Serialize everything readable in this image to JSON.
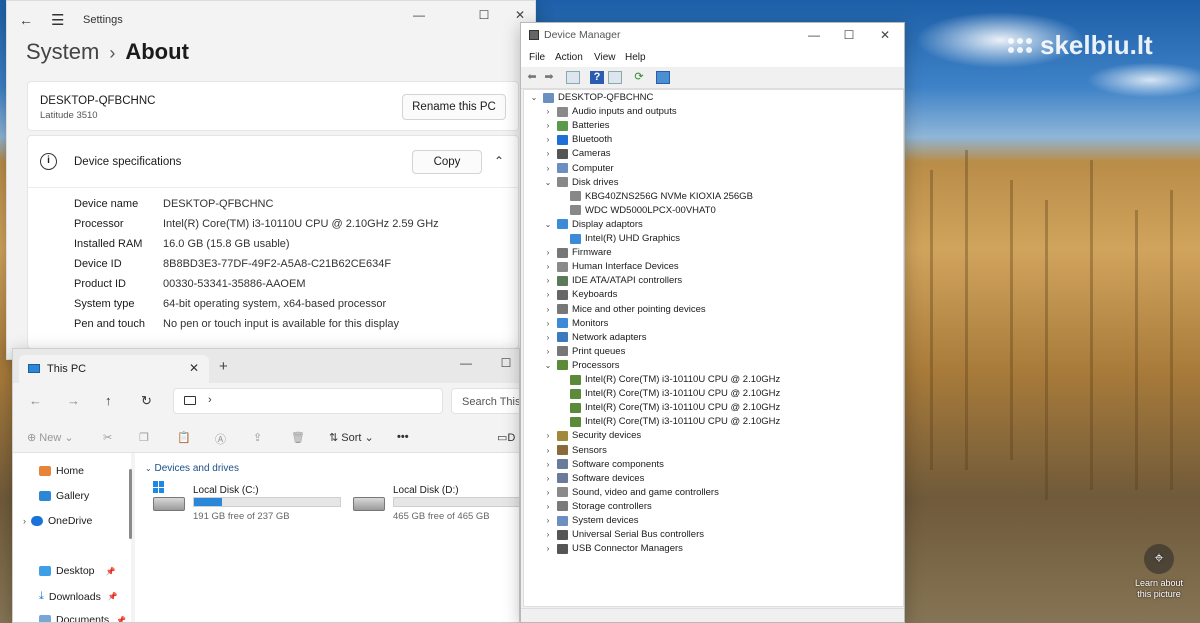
{
  "watermark": {
    "text": "skelbiu.lt"
  },
  "desktop": {
    "learn_about": "Learn about this picture"
  },
  "settings": {
    "window_title": "Settings",
    "breadcrumb_parent": "System",
    "breadcrumb_separator": "›",
    "breadcrumb_current": "About",
    "device_name": "DESKTOP-QFBCHNC",
    "device_model": "Latitude 3510",
    "rename_label": "Rename this PC",
    "specs_title": "Device specifications",
    "copy_label": "Copy",
    "specs": [
      {
        "label": "Device name",
        "value": "DESKTOP-QFBCHNC"
      },
      {
        "label": "Processor",
        "value": "Intel(R) Core(TM) i3-10110U CPU @ 2.10GHz   2.59 GHz"
      },
      {
        "label": "Installed RAM",
        "value": "16.0 GB (15.8 GB usable)"
      },
      {
        "label": "Device ID",
        "value": "8B8BD3E3-77DF-49F2-A5A8-C21B62CE634F"
      },
      {
        "label": "Product ID",
        "value": "00330-53341-35886-AAOEM"
      },
      {
        "label": "System type",
        "value": "64-bit operating system, x64-based processor"
      },
      {
        "label": "Pen and touch",
        "value": "No pen or touch input is available for this display"
      }
    ]
  },
  "explorer": {
    "tab_title": "This PC",
    "search_placeholder": "Search This",
    "cmd": {
      "new": "New",
      "sort": "Sort",
      "more": "•••",
      "details": "D"
    },
    "nav": [
      {
        "label": "Home"
      },
      {
        "label": "Gallery"
      },
      {
        "label": "OneDrive"
      },
      {
        "label": "Desktop"
      },
      {
        "label": "Downloads"
      },
      {
        "label": "Documents"
      }
    ],
    "group_title": "Devices and drives",
    "drives": [
      {
        "name": "Local Disk (C:)",
        "free_text": "191 GB free of 237 GB",
        "used_fraction": 0.19
      },
      {
        "name": "Local Disk (D:)",
        "free_text": "465 GB free of 465 GB",
        "used_fraction": 0.0
      }
    ]
  },
  "device_manager": {
    "window_title": "Device Manager",
    "menu": [
      "File",
      "Action",
      "View",
      "Help"
    ],
    "root": "DESKTOP-QFBCHNC",
    "nodes": [
      {
        "label": "Audio inputs and outputs",
        "icon": "speaker-icon",
        "expanded": false
      },
      {
        "label": "Batteries",
        "icon": "battery-icon",
        "expanded": false
      },
      {
        "label": "Bluetooth",
        "icon": "bluetooth-icon",
        "expanded": false
      },
      {
        "label": "Cameras",
        "icon": "camera-icon",
        "expanded": false
      },
      {
        "label": "Computer",
        "icon": "computer-icon",
        "expanded": false
      },
      {
        "label": "Disk drives",
        "icon": "disk-icon",
        "expanded": true,
        "children": [
          "KBG40ZNS256G NVMe KIOXIA 256GB",
          "WDC WD5000LPCX-00VHAT0"
        ]
      },
      {
        "label": "Display adaptors",
        "icon": "display-icon",
        "expanded": true,
        "children": [
          "Intel(R) UHD Graphics"
        ]
      },
      {
        "label": "Firmware",
        "icon": "firmware-icon",
        "expanded": false
      },
      {
        "label": "Human Interface Devices",
        "icon": "hid-icon",
        "expanded": false
      },
      {
        "label": "IDE ATA/ATAPI controllers",
        "icon": "ide-icon",
        "expanded": false
      },
      {
        "label": "Keyboards",
        "icon": "keyboard-icon",
        "expanded": false
      },
      {
        "label": "Mice and other pointing devices",
        "icon": "mouse-icon",
        "expanded": false
      },
      {
        "label": "Monitors",
        "icon": "monitor-icon",
        "expanded": false
      },
      {
        "label": "Network adapters",
        "icon": "network-icon",
        "expanded": false
      },
      {
        "label": "Print queues",
        "icon": "printer-icon",
        "expanded": false
      },
      {
        "label": "Processors",
        "icon": "processor-icon",
        "expanded": true,
        "children": [
          "Intel(R) Core(TM) i3-10110U CPU @ 2.10GHz",
          "Intel(R) Core(TM) i3-10110U CPU @ 2.10GHz",
          "Intel(R) Core(TM) i3-10110U CPU @ 2.10GHz",
          "Intel(R) Core(TM) i3-10110U CPU @ 2.10GHz"
        ]
      },
      {
        "label": "Security devices",
        "icon": "security-icon",
        "expanded": false
      },
      {
        "label": "Sensors",
        "icon": "sensor-icon",
        "expanded": false
      },
      {
        "label": "Software components",
        "icon": "software-component-icon",
        "expanded": false
      },
      {
        "label": "Software devices",
        "icon": "software-device-icon",
        "expanded": false
      },
      {
        "label": "Sound, video and game controllers",
        "icon": "sound-icon",
        "expanded": false
      },
      {
        "label": "Storage controllers",
        "icon": "storage-icon",
        "expanded": false
      },
      {
        "label": "System devices",
        "icon": "system-icon",
        "expanded": false
      },
      {
        "label": "Universal Serial Bus controllers",
        "icon": "usb-icon",
        "expanded": false
      },
      {
        "label": "USB Connector Managers",
        "icon": "usb-connector-icon",
        "expanded": false
      }
    ]
  }
}
